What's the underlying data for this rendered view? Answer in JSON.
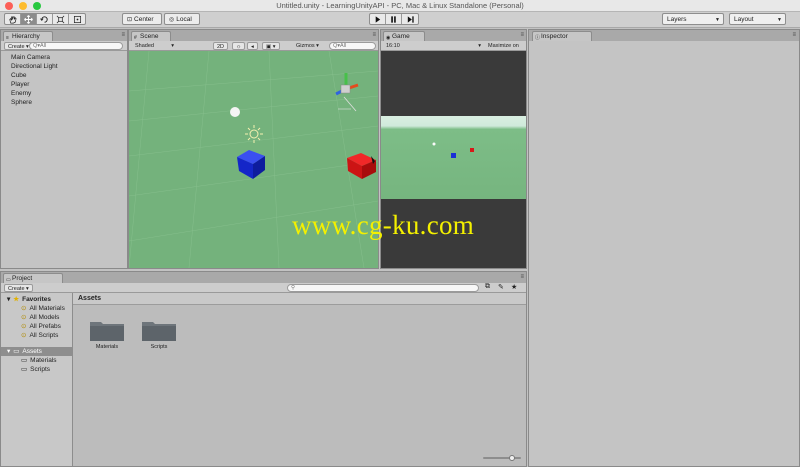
{
  "window": {
    "title": "Untitled.unity - LearningUnityAPI - PC, Mac & Linux Standalone (Personal)"
  },
  "toolbar": {
    "pivot_label": "Center",
    "space_label": "Local",
    "layers_label": "Layers",
    "layout_label": "Layout",
    "tools": [
      "hand-tool",
      "move-tool",
      "rotate-tool",
      "scale-tool",
      "rect-tool"
    ]
  },
  "hierarchy": {
    "tab_label": "Hierarchy",
    "create_label": "Create",
    "search_placeholder": "Q▾All",
    "items": [
      "Main Camera",
      "Directional Light",
      "Cube",
      "Player",
      "Enemy",
      "Sphere"
    ]
  },
  "scene": {
    "tab_label": "Scene",
    "shading_mode": "Shaded",
    "mode_2d": "2D",
    "gizmos_label": "Gizmos",
    "search_placeholder": "Q▾All",
    "persp_label": "Persp"
  },
  "game": {
    "tab_label": "Game",
    "aspect": "16:10",
    "maximize_label": "Maximize on"
  },
  "inspector": {
    "tab_label": "Inspector"
  },
  "project": {
    "tab_label": "Project",
    "create_label": "Create",
    "favorites_label": "Favorites",
    "favorites": [
      "All Materials",
      "All Models",
      "All Prefabs",
      "All Scripts"
    ],
    "assets_label": "Assets",
    "asset_folders": [
      "Materials",
      "Scripts"
    ],
    "breadcrumb": "Assets",
    "folders": [
      "Materials",
      "Scripts"
    ],
    "zoom_level": 0.75
  },
  "watermark": {
    "text": "www.cg-ku.com"
  },
  "colors": {
    "ground": "#74b27c",
    "cube_blue": "#1a2fd6",
    "cube_red": "#d81818",
    "game_bg": "#3a3a3a",
    "watermark": "#f4f000"
  }
}
